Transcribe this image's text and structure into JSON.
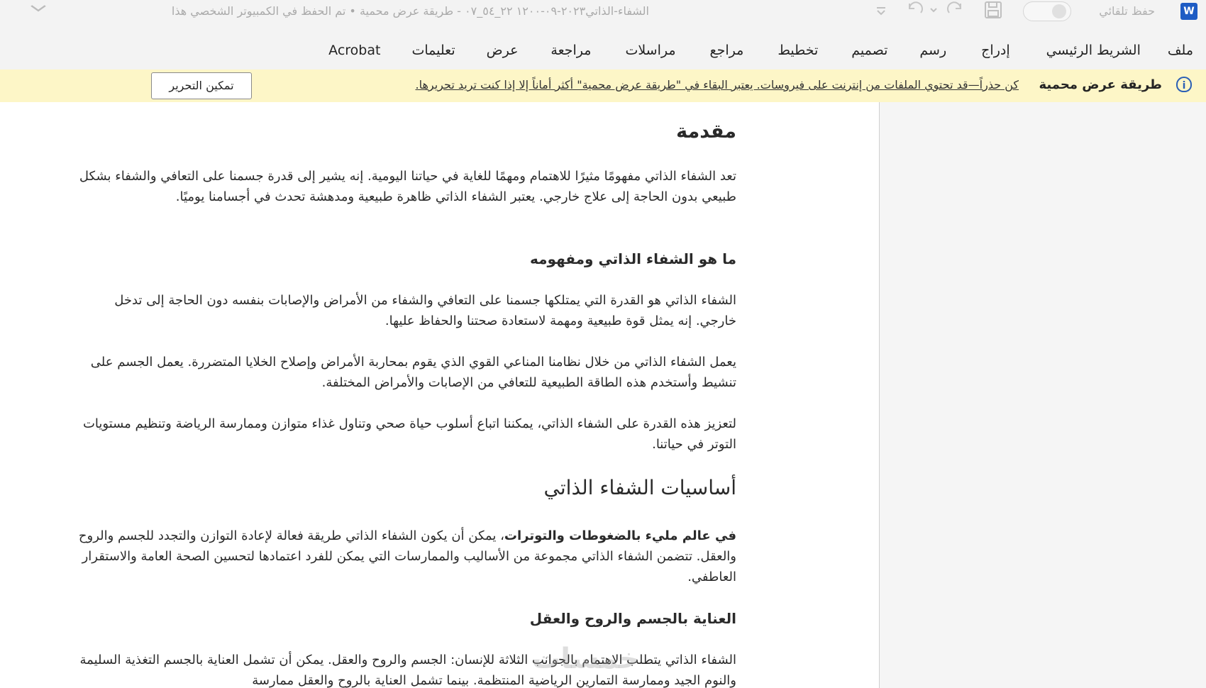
{
  "titlebar": {
    "app_icon": "word-icon",
    "app_icon_letter": "W",
    "autosave_label": "حفظ تلقائي",
    "document_title": "الشفاء-الذاتي٢٠٢٣-٠٩-١٢٠٠ ٢٢_٥٤_٠٧  -  طريقة عرض محمية • تم الحفظ في الكمبيوتر الشخصي هذا"
  },
  "ribbon": {
    "tabs": [
      "ملف",
      "الشريط الرئيسي",
      "إدراج",
      "رسم",
      "تصميم",
      "تخطيط",
      "مراجع",
      "مراسلات",
      "مراجعة",
      "عرض",
      "تعليمات",
      "Acrobat"
    ]
  },
  "protected_view": {
    "title": "طريقة عرض محمية",
    "message": "كن حذراً—قد تحتوي الملفات من إنترنت على فيروسات. يعتبر البقاء في \"طريقة عرض محمية\" أكثر أماناً إلا إذا كنت تريد تحريرها.",
    "enable_editing": "تمكين التحرير"
  },
  "document": {
    "intro_heading": "مقدمة",
    "intro_paragraph": "تعد الشفاء الذاتي مفهومًا مثيرًا للاهتمام ومهمًا للغاية في حياتنا اليومية. إنه يشير إلى قدرة جسمنا على التعافي والشفاء بشكل طبيعي بدون الحاجة إلى علاج خارجي. يعتبر الشفاء الذاتي ظاهرة طبيعية ومدهشة تحدث في أجسامنا يوميًا.",
    "what_heading": "ما هو الشفاء الذاتي ومفهومه",
    "what_paragraph_1": "الشفاء الذاتي هو القدرة التي يمتلكها جسمنا على التعافي والشفاء من الأمراض والإصابات بنفسه دون الحاجة إلى تدخل خارجي. إنه يمثل قوة طبيعية ومهمة لاستعادة صحتنا والحفاظ عليها.",
    "what_paragraph_2": "يعمل الشفاء الذاتي من خلال نظامنا المناعي القوي الذي يقوم بمحاربة الأمراض وإصلاح الخلايا المتضررة. يعمل الجسم على تنشيط وأستخدم هذه الطاقة الطبيعية للتعافي من الإصابات والأمراض المختلفة.",
    "what_paragraph_3": "لتعزيز هذه القدرة على الشفاء الذاتي، يمكننا اتباع أسلوب حياة صحي وتناول غذاء متوازن وممارسة الرياضة وتنظيم مستويات التوتر في حياتنا.",
    "basics_heading": "أساسيات الشفاء الذاتي",
    "basics_bold": "في عالم مليء بالضغوطات والتوترات",
    "basics_paragraph": "، يمكن أن يكون الشفاء الذاتي طريقة فعالة لإعادة التوازن والتجدد للجسم والروح والعقل. تتضمن الشفاء الذاتي مجموعة من الأساليب والممارسات التي يمكن للفرد اعتمادها لتحسين الصحة العامة والاستقرار العاطفي.",
    "care_heading": "العناية بالجسم والروح والعقل",
    "care_paragraph": "الشفاء الذاتي يتطلب الاهتمام بالجوانب الثلاثة للإنسان: الجسم والروح والعقل. يمكن أن تشمل العناية بالجسم التغذية السليمة والنوم الجيد وممارسة التمارين الرياضية المنتظمة. بينما تشمل العناية بالروح والعقل ممارسة"
  },
  "watermark": "خمسات"
}
